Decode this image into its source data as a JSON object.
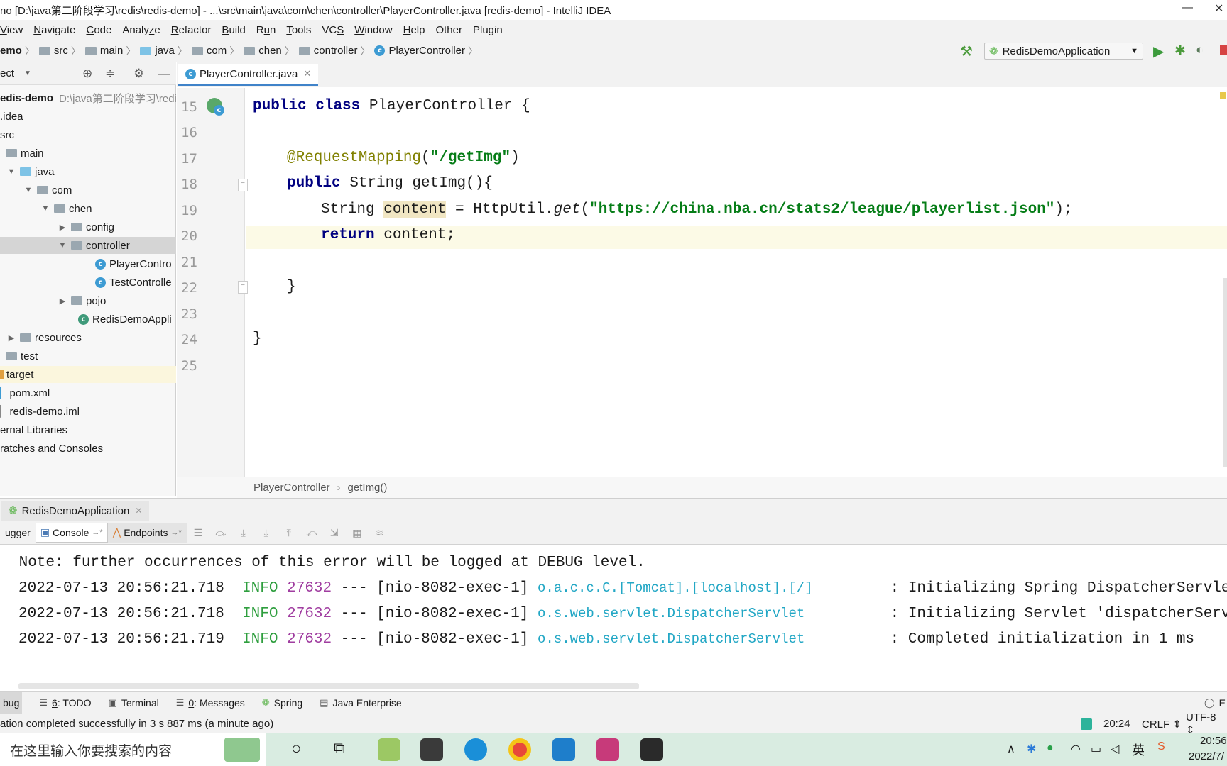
{
  "window": {
    "title": "no [D:\\java第二阶段学习\\redis\\redis-demo] - ...\\src\\main\\java\\com\\chen\\controller\\PlayerController.java [redis-demo] - IntelliJ IDEA",
    "minimize": "—",
    "close": "✕"
  },
  "menu": {
    "items": [
      {
        "pre": "",
        "u": "V",
        "post": "iew"
      },
      {
        "pre": "",
        "u": "N",
        "post": "avigate"
      },
      {
        "pre": "",
        "u": "C",
        "post": "ode"
      },
      {
        "pre": "Analy",
        "u": "z",
        "post": "e"
      },
      {
        "pre": "",
        "u": "R",
        "post": "efactor"
      },
      {
        "pre": "",
        "u": "B",
        "post": "uild"
      },
      {
        "pre": "R",
        "u": "u",
        "post": "n"
      },
      {
        "pre": "",
        "u": "T",
        "post": "ools"
      },
      {
        "pre": "VC",
        "u": "S",
        "post": ""
      },
      {
        "pre": "",
        "u": "W",
        "post": "indow"
      },
      {
        "pre": "",
        "u": "H",
        "post": "elp"
      },
      {
        "pre": "Other",
        "u": "",
        "post": ""
      },
      {
        "pre": "Plugin",
        "u": "",
        "post": ""
      }
    ]
  },
  "nav": {
    "crumbs": [
      "emo",
      "src",
      "main",
      "java",
      "com",
      "chen",
      "controller",
      "PlayerController"
    ],
    "run_config": "RedisDemoApplication"
  },
  "project": {
    "header": "ect",
    "tree": [
      {
        "label": "edis-demo",
        "extra": "D:\\java第二阶段学习\\redis",
        "bold": true
      },
      {
        "label": ".idea"
      },
      {
        "label": "src"
      },
      {
        "label": "main"
      },
      {
        "label": "java"
      },
      {
        "label": "com"
      },
      {
        "label": "chen"
      },
      {
        "label": "config"
      },
      {
        "label": "controller"
      },
      {
        "label": "PlayerContro"
      },
      {
        "label": "TestControlle"
      },
      {
        "label": "pojo"
      },
      {
        "label": "RedisDemoAppli"
      },
      {
        "label": "resources"
      },
      {
        "label": "test"
      },
      {
        "label": "target"
      },
      {
        "label": "pom.xml"
      },
      {
        "label": "redis-demo.iml"
      },
      {
        "label": "ernal Libraries"
      },
      {
        "label": "ratches and Consoles"
      }
    ]
  },
  "editor": {
    "tab": "PlayerController.java",
    "line_numbers": [
      "15",
      "16",
      "17",
      "18",
      "19",
      "20",
      "21",
      "22",
      "23",
      "24",
      "25"
    ],
    "code": {
      "l15_kw1": "public",
      "l15_kw2": "class",
      "l15_rest": " PlayerController {",
      "l17_ann": "@RequestMapping",
      "l17_p1": "(",
      "l17_str": "\"/getImg\"",
      "l17_p2": ")",
      "l18_kw": "public",
      "l18_rest": " String getImg(){",
      "l19_a": "String ",
      "l19_var": "content",
      "l19_b": " = HttpUtil.",
      "l19_get": "get",
      "l19_c": "(",
      "l19_str": "\"https://china.nba.cn/stats2/league/playerlist.json\"",
      "l19_d": ");",
      "l20_kw": "return",
      "l20_rest": " content;",
      "l22": "}",
      "l24": "}"
    },
    "breadcrumb": [
      "PlayerController",
      "getImg()"
    ]
  },
  "run": {
    "tab": "RedisDemoApplication",
    "tools": [
      "ugger",
      "Console",
      "Endpoints"
    ],
    "console": {
      "note": " Note: further occurrences of this error will be logged at DEBUG level.",
      "lines": [
        {
          "ts": "2022-07-13 20:56:21.718",
          "level": "INFO",
          "pid": "27632",
          "sep": "---",
          "thread": "[nio-8082-exec-1]",
          "logger": "o.a.c.c.C.[Tomcat].[localhost].[/]",
          "msg": ": Initializing Spring DispatcherServlet 'di"
        },
        {
          "ts": "2022-07-13 20:56:21.718",
          "level": "INFO",
          "pid": "27632",
          "sep": "---",
          "thread": "[nio-8082-exec-1]",
          "logger": "o.s.web.servlet.DispatcherServlet",
          "msg": ": Initializing Servlet 'dispatcherServlet'"
        },
        {
          "ts": "2022-07-13 20:56:21.719",
          "level": "INFO",
          "pid": "27632",
          "sep": "---",
          "thread": "[nio-8082-exec-1]",
          "logger": "o.s.web.servlet.DispatcherServlet",
          "msg": ": Completed initialization in 1 ms"
        }
      ]
    }
  },
  "toolwindows": {
    "debug": "bug",
    "todo_num": "6",
    "todo": ": TODO",
    "terminal": "Terminal",
    "messages_num": "0",
    "messages": ": Messages",
    "spring": "Spring",
    "javaee": "Java Enterprise",
    "event": "E"
  },
  "status": {
    "message": "ation completed successfully in 3 s 887 ms (a minute ago)",
    "position": "20:24",
    "line_sep": "CRLF",
    "encoding": "UTF-8"
  },
  "taskbar": {
    "search_placeholder": "在这里输入你要搜索的内容",
    "ime": "英",
    "time": "20:56",
    "date": "2022/7/"
  },
  "colors": {
    "accent": "#4083c9",
    "info": "#2e9e3e",
    "logger": "#22a7c5",
    "keyword": "#000080",
    "string": "#067d17"
  }
}
